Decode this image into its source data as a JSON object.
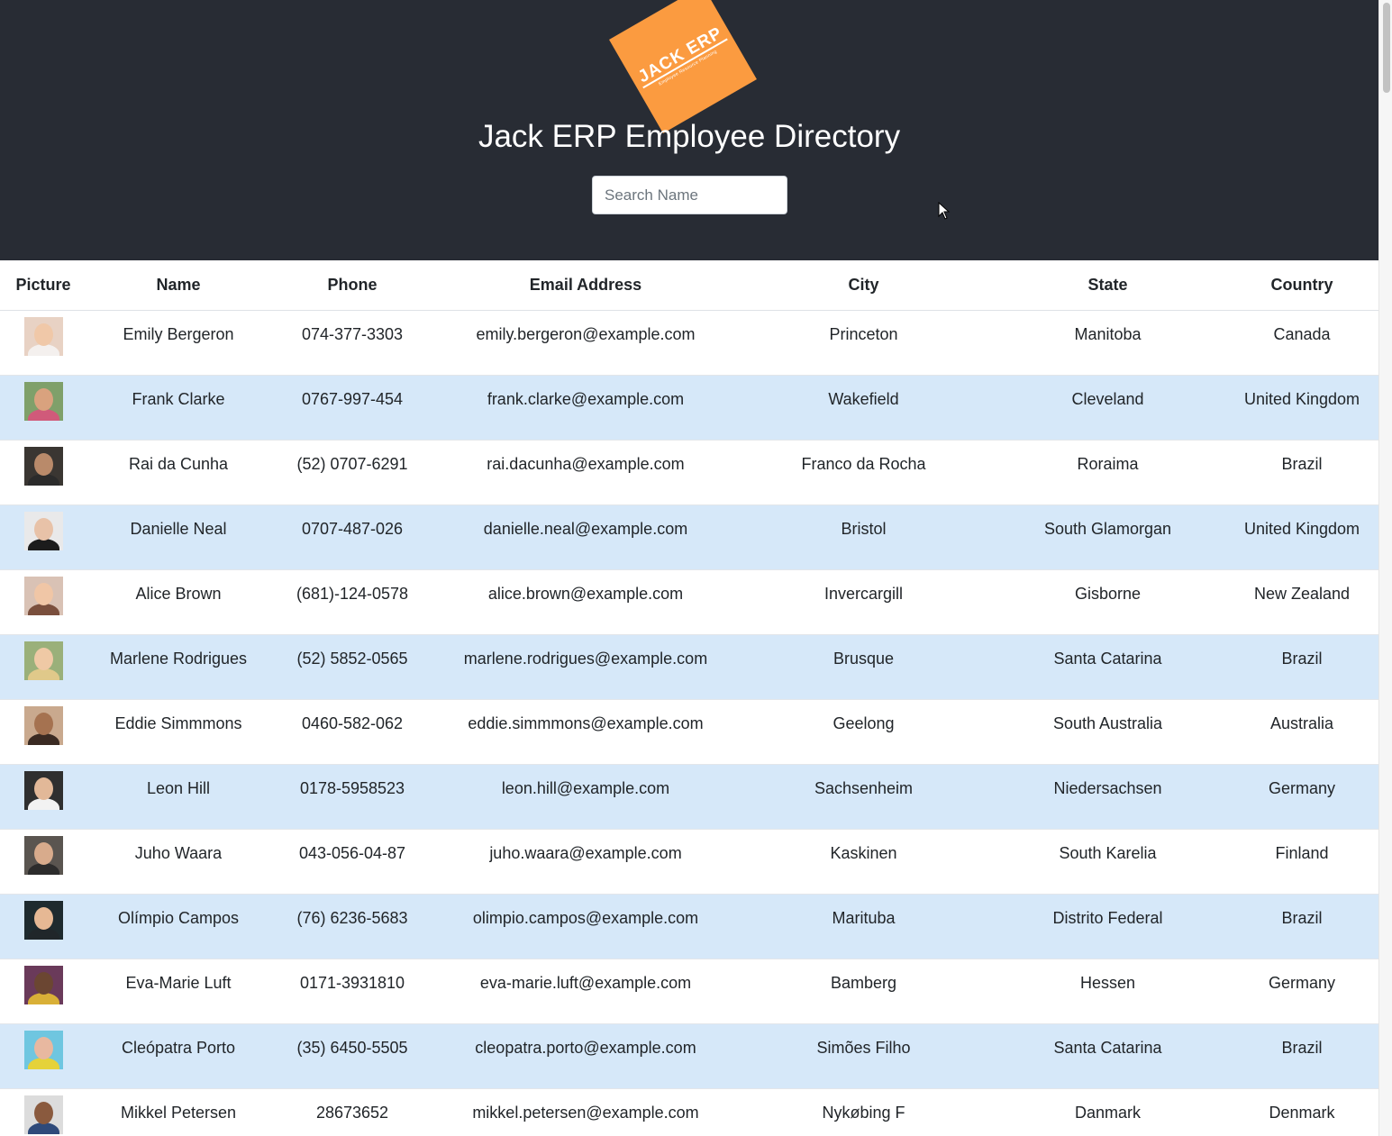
{
  "header": {
    "logo_text": "JACK ERP",
    "logo_subtext": "Employee Resource Planning",
    "title": "Jack ERP Employee Directory",
    "search_placeholder": "Search Name",
    "search_value": ""
  },
  "table": {
    "columns": [
      "Picture",
      "Name",
      "Phone",
      "Email Address",
      "City",
      "State",
      "Country"
    ],
    "rows": [
      {
        "name": "Emily Bergeron",
        "phone": "074-377-3303",
        "email": "emily.bergeron@example.com",
        "city": "Princeton",
        "state": "Manitoba",
        "country": "Canada",
        "bg": "#e8d2c4",
        "face": "#f0c8a8",
        "shirt": "#f4f0ee"
      },
      {
        "name": "Frank Clarke",
        "phone": "0767-997-454",
        "email": "frank.clarke@example.com",
        "city": "Wakefield",
        "state": "Cleveland",
        "country": "United Kingdom",
        "bg": "#7fa06a",
        "face": "#d9a27e",
        "shirt": "#d05a7a"
      },
      {
        "name": "Rai da Cunha",
        "phone": "(52) 0707-6291",
        "email": "rai.dacunha@example.com",
        "city": "Franco da Rocha",
        "state": "Roraima",
        "country": "Brazil",
        "bg": "#3a3632",
        "face": "#b98a6a",
        "shirt": "#2b2b2b"
      },
      {
        "name": "Danielle Neal",
        "phone": "0707-487-026",
        "email": "danielle.neal@example.com",
        "city": "Bristol",
        "state": "South Glamorgan",
        "country": "United Kingdom",
        "bg": "#e9e9ea",
        "face": "#e8c2a8",
        "shirt": "#1c1c1c"
      },
      {
        "name": "Alice Brown",
        "phone": "(681)-124-0578",
        "email": "alice.brown@example.com",
        "city": "Invercargill",
        "state": "Gisborne",
        "country": "New Zealand",
        "bg": "#d9c2b5",
        "face": "#f0c6a6",
        "shirt": "#7a4f3d"
      },
      {
        "name": "Marlene Rodrigues",
        "phone": "(52) 5852-0565",
        "email": "marlene.rodrigues@example.com",
        "city": "Brusque",
        "state": "Santa Catarina",
        "country": "Brazil",
        "bg": "#9ab07a",
        "face": "#efc9a5",
        "shirt": "#e0c98a"
      },
      {
        "name": "Eddie Simmmons",
        "phone": "0460-582-062",
        "email": "eddie.simmmons@example.com",
        "city": "Geelong",
        "state": "South Australia",
        "country": "Australia",
        "bg": "#c9a98e",
        "face": "#a57250",
        "shirt": "#3a2a22"
      },
      {
        "name": "Leon Hill",
        "phone": "0178-5958523",
        "email": "leon.hill@example.com",
        "city": "Sachsenheim",
        "state": "Niedersachsen",
        "country": "Germany",
        "bg": "#2f2f2f",
        "face": "#e2b898",
        "shirt": "#f2f2f2"
      },
      {
        "name": "Juho Waara",
        "phone": "043-056-04-87",
        "email": "juho.waara@example.com",
        "city": "Kaskinen",
        "state": "South Karelia",
        "country": "Finland",
        "bg": "#5a5550",
        "face": "#d8ab8c",
        "shirt": "#2c2c2c"
      },
      {
        "name": "Olímpio Campos",
        "phone": "(76) 6236-5683",
        "email": "olimpio.campos@example.com",
        "city": "Marituba",
        "state": "Distrito Federal",
        "country": "Brazil",
        "bg": "#1e2a2e",
        "face": "#e6b894",
        "shirt": "#20262a"
      },
      {
        "name": "Eva-Marie Luft",
        "phone": "0171-3931810",
        "email": "eva-marie.luft@example.com",
        "city": "Bamberg",
        "state": "Hessen",
        "country": "Germany",
        "bg": "#6a3a5a",
        "face": "#6b4632",
        "shirt": "#d9b037"
      },
      {
        "name": "Cleópatra Porto",
        "phone": "(35) 6450-5505",
        "email": "cleopatra.porto@example.com",
        "city": "Simões Filho",
        "state": "Santa Catarina",
        "country": "Brazil",
        "bg": "#6fc6e0",
        "face": "#e8b8a0",
        "shirt": "#e5d23a"
      },
      {
        "name": "Mikkel Petersen",
        "phone": "28673652",
        "email": "mikkel.petersen@example.com",
        "city": "Nykøbing F",
        "state": "Danmark",
        "country": "Denmark",
        "bg": "#dcdcdc",
        "face": "#8a5a3e",
        "shirt": "#2f4a7a"
      }
    ]
  }
}
